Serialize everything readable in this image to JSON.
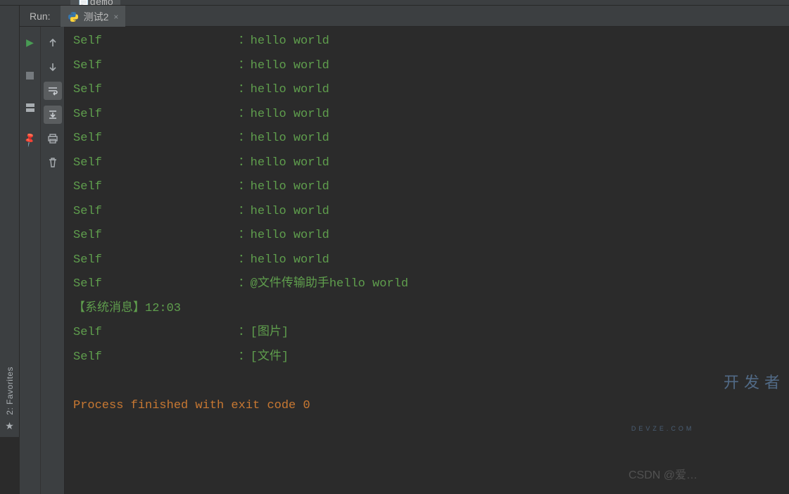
{
  "topbar": {
    "file_tab_label": "demo"
  },
  "sidebar": {
    "favorites_label": "2: Favorites"
  },
  "run": {
    "label": "Run:",
    "tab_name": "测试2",
    "tab_close": "×"
  },
  "toolbar_left": {
    "play": "play-icon",
    "stop": "stop-icon",
    "layout": "layout-icon",
    "pin": "pin-icon"
  },
  "toolbar_inner": {
    "up": "arrow-up-icon",
    "down": "arrow-down-icon",
    "wrap": "wrap-icon",
    "scroll": "scroll-to-end-icon",
    "print": "print-icon",
    "trash": "trash-icon"
  },
  "output": {
    "lines": [
      "Self                   ：hello world",
      "Self                   ：hello world",
      "Self                   ：hello world",
      "Self                   ：hello world",
      "Self                   ：hello world",
      "Self                   ：hello world",
      "Self                   ：hello world",
      "Self                   ：hello world",
      "Self                   ：hello world",
      "Self                   ：hello world",
      "Self                   ：@文件传输助手hello world",
      "【系统消息】12:03",
      "Self                   ：[图片]",
      "Self                   ：[文件]"
    ],
    "blank": "",
    "exit_line": "Process finished with exit code 0"
  },
  "watermark": {
    "csdn": "CSDN @爱…",
    "brand_line1": "开发者",
    "brand_line2": "DEVZE.COM"
  }
}
